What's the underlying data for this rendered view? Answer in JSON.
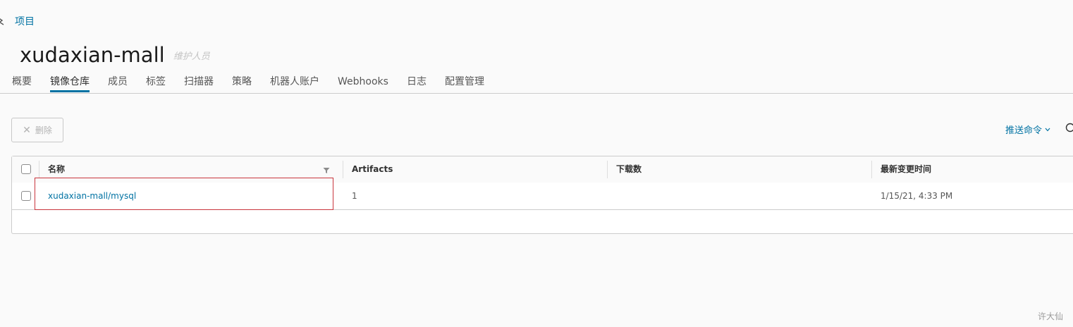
{
  "breadcrumb": {
    "back_icon": "back-arrow-icon",
    "project_link": "项目"
  },
  "header": {
    "title": "xudaxian-mall",
    "role": "维护人员"
  },
  "tabs": [
    {
      "label": "概要",
      "active": false
    },
    {
      "label": "镜像仓库",
      "active": true
    },
    {
      "label": "成员",
      "active": false
    },
    {
      "label": "标签",
      "active": false
    },
    {
      "label": "扫描器",
      "active": false
    },
    {
      "label": "策略",
      "active": false
    },
    {
      "label": "机器人账户",
      "active": false
    },
    {
      "label": "Webhooks",
      "active": false
    },
    {
      "label": "日志",
      "active": false
    },
    {
      "label": "配置管理",
      "active": false
    }
  ],
  "toolbar": {
    "delete_label": "删除",
    "delete_icon": "close-icon",
    "push_command_label": "推送命令",
    "refresh_icon": "refresh-icon"
  },
  "table": {
    "columns": [
      "名称",
      "Artifacts",
      "下载数",
      "最新变更时间"
    ],
    "rows": [
      {
        "name": "xudaxian-mall/mysql",
        "artifacts": "1",
        "downloads": "",
        "updated": "1/15/21, 4:33 PM"
      }
    ]
  },
  "watermark": "许大仙",
  "colors": {
    "link": "#0072a3",
    "highlight": "#c9353d",
    "active_tab_underline": "#0072a3"
  }
}
